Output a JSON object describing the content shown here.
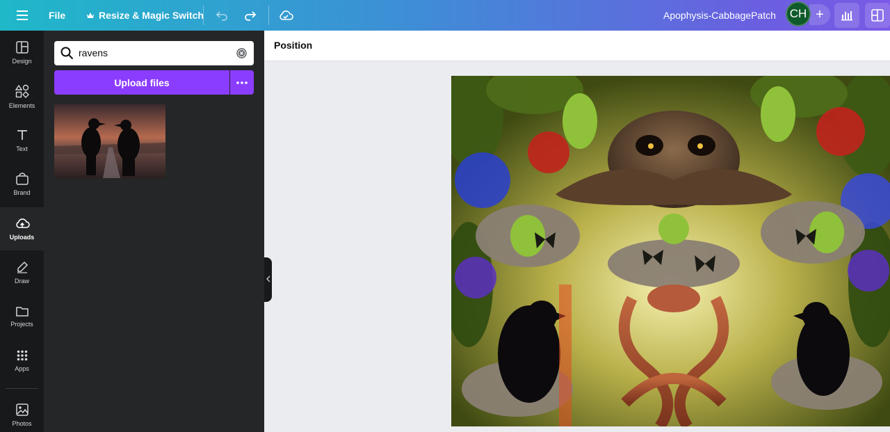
{
  "topbar": {
    "menu_icon": "hamburger-menu-icon",
    "file_label": "File",
    "resize_label": "Resize & Magic Switch",
    "resize_icon": "crown-icon",
    "undo_icon": "undo-icon",
    "redo_icon": "redo-icon",
    "save_icon": "cloud-sync-icon",
    "doc_title": "Apophysis-CabbagePatch",
    "avatar_initials": "CH",
    "add_label": "+",
    "insights_icon": "bar-chart-icon",
    "layout_icon": "layout-icon"
  },
  "rail": {
    "items": [
      {
        "label": "Design",
        "icon": "design-icon"
      },
      {
        "label": "Elements",
        "icon": "elements-icon"
      },
      {
        "label": "Text",
        "icon": "text-icon"
      },
      {
        "label": "Brand",
        "icon": "brand-icon"
      },
      {
        "label": "Uploads",
        "icon": "upload-cloud-icon",
        "active": true
      },
      {
        "label": "Draw",
        "icon": "draw-icon"
      },
      {
        "label": "Projects",
        "icon": "folder-icon"
      },
      {
        "label": "Apps",
        "icon": "apps-grid-icon"
      },
      {
        "label": "Photos",
        "icon": "photo-icon"
      }
    ]
  },
  "panel": {
    "search_value": "ravens",
    "upload_label": "Upload files",
    "more_icon": "more-dots-icon",
    "thumbnail_alt": "two ravens on road"
  },
  "context_toolbar": {
    "position_label": "Position"
  },
  "colors": {
    "accent": "#8b3dff",
    "rail_bg": "#18191b",
    "panel_bg": "#252627",
    "canvas_bg": "#ebecf0"
  }
}
